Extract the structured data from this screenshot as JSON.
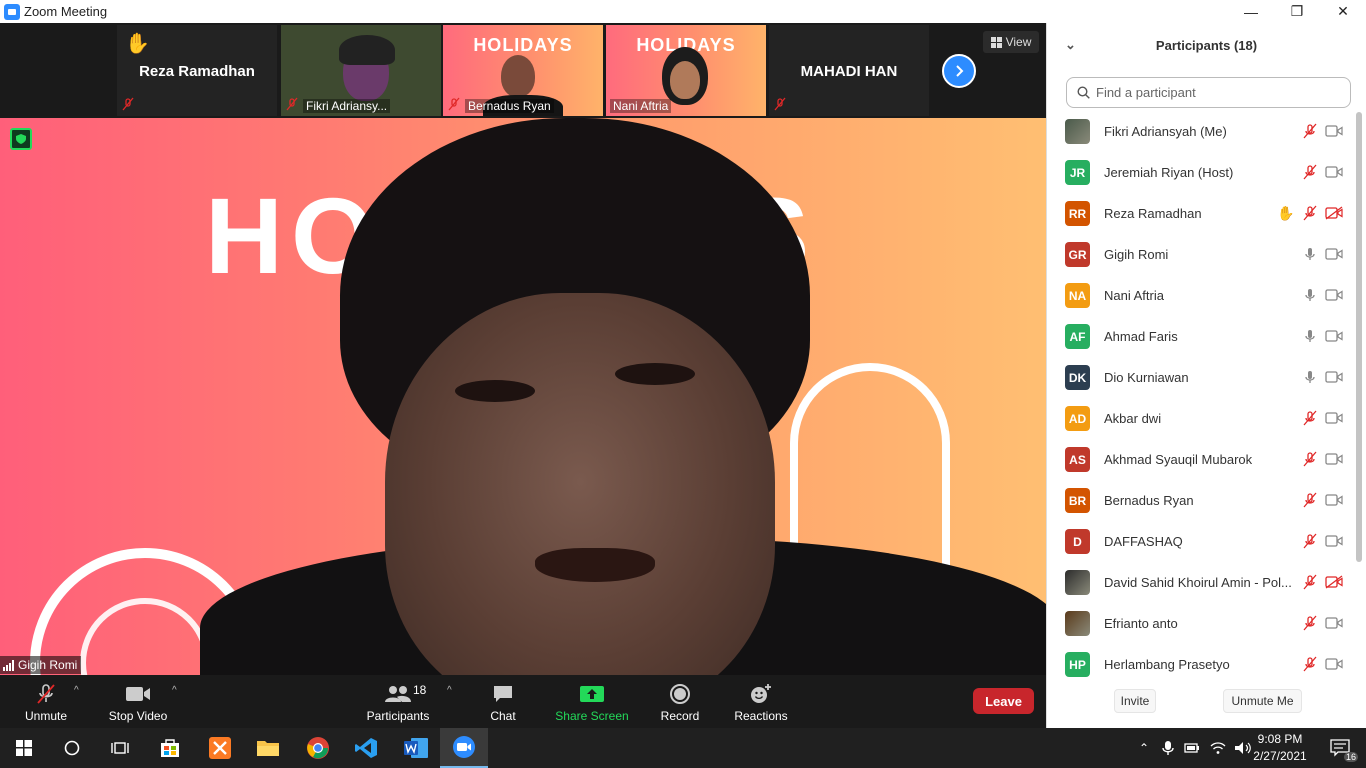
{
  "window": {
    "title": "Zoom Meeting",
    "controls": [
      "minimize",
      "maximize",
      "close"
    ]
  },
  "thumbnails": [
    {
      "name": "Reza Ramadhan",
      "type": "name-only",
      "hand_raised": true,
      "muted": true
    },
    {
      "name": "Fikri Adriansy...",
      "type": "video",
      "muted": true
    },
    {
      "name": "Bernadus Ryan",
      "type": "video",
      "background_text": "HOLIDAYS",
      "muted": true
    },
    {
      "name": "Nani Aftria",
      "type": "video",
      "background_text": "HOLIDAYS",
      "muted": false
    },
    {
      "name": "MAHADI HAN",
      "type": "name-only",
      "muted": true
    }
  ],
  "view_button": {
    "label": "View"
  },
  "main_video": {
    "background_text": "HOLIDAYS",
    "speaker_name": "Gigih Romi"
  },
  "toolbar": {
    "unmute": "Unmute",
    "stop_video": "Stop Video",
    "participants": "Participants",
    "participant_count": "18",
    "chat": "Chat",
    "share_screen": "Share Screen",
    "record": "Record",
    "reactions": "Reactions",
    "leave": "Leave"
  },
  "panel": {
    "title": "Participants (18)",
    "search_placeholder": "Find a participant",
    "participants": [
      {
        "name": "Fikri Adriansyah (Me)",
        "initials": "",
        "color": "#4a5a4a",
        "photo": true,
        "mic": "muted",
        "video": "on",
        "hand": false
      },
      {
        "name": "Jeremiah Riyan (Host)",
        "initials": "JR",
        "color": "#27ae60",
        "mic": "muted",
        "video": "on",
        "hand": false
      },
      {
        "name": "Reza Ramadhan",
        "initials": "RR",
        "color": "#d35400",
        "mic": "muted",
        "video": "off",
        "hand": true
      },
      {
        "name": "Gigih Romi",
        "initials": "GR",
        "color": "#c0392b",
        "mic": "on",
        "video": "on",
        "hand": false
      },
      {
        "name": "Nani Aftria",
        "initials": "NA",
        "color": "#f39c12",
        "mic": "on",
        "video": "on",
        "hand": false
      },
      {
        "name": "Ahmad Faris",
        "initials": "AF",
        "color": "#27ae60",
        "mic": "on",
        "video": "on",
        "hand": false
      },
      {
        "name": "Dio Kurniawan",
        "initials": "DK",
        "color": "#2c3e50",
        "mic": "on",
        "video": "on",
        "hand": false
      },
      {
        "name": "Akbar dwi",
        "initials": "AD",
        "color": "#f39c12",
        "mic": "muted",
        "video": "on",
        "hand": false
      },
      {
        "name": "Akhmad Syauqil Mubarok",
        "initials": "AS",
        "color": "#c0392b",
        "mic": "muted",
        "video": "on",
        "hand": false
      },
      {
        "name": "Bernadus Ryan",
        "initials": "BR",
        "color": "#d35400",
        "mic": "muted",
        "video": "on",
        "hand": false
      },
      {
        "name": "DAFFASHAQ",
        "initials": "D",
        "color": "#c0392b",
        "mic": "muted",
        "video": "on",
        "hand": false
      },
      {
        "name": "David Sahid Khoirul Amin - Pol...",
        "initials": "",
        "color": "#2c2c2c",
        "photo": true,
        "mic": "muted",
        "video": "off",
        "hand": false
      },
      {
        "name": "Efrianto anto",
        "initials": "",
        "color": "#5a3a1a",
        "photo": true,
        "mic": "muted",
        "video": "on",
        "hand": false
      },
      {
        "name": "Herlambang Prasetyo",
        "initials": "HP",
        "color": "#27ae60",
        "mic": "muted",
        "video": "on",
        "hand": false
      }
    ],
    "invite": "Invite",
    "unmute_me": "Unmute Me"
  },
  "taskbar": {
    "time": "9:08 PM",
    "date": "2/27/2021",
    "notification_count": "16",
    "apps": [
      "start-icon",
      "search-icon",
      "task-view-icon",
      "store-icon",
      "xampp-icon",
      "file-explorer-icon",
      "chrome-icon",
      "vscode-icon",
      "word-icon",
      "zoom-icon"
    ]
  }
}
